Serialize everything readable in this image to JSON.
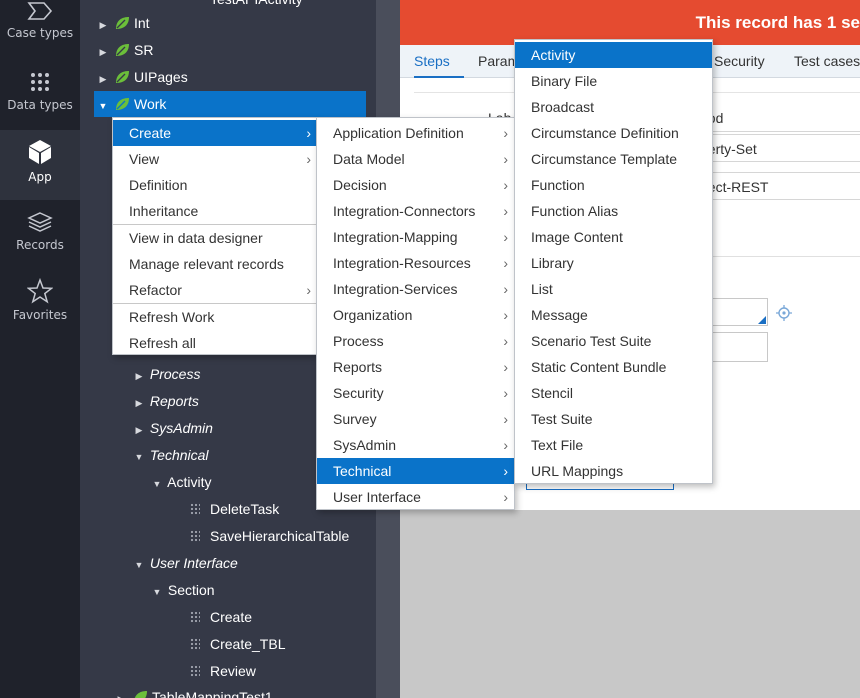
{
  "nav": [
    {
      "label": "Case types",
      "icon": "case-types-icon"
    },
    {
      "label": "Data types",
      "icon": "data-types-icon"
    },
    {
      "label": "App",
      "icon": "app-cube-icon"
    },
    {
      "label": "Records",
      "icon": "records-stack-icon"
    },
    {
      "label": "Favorites",
      "icon": "favorites-star-icon"
    }
  ],
  "tree": {
    "partial_top": "TestAPIActivity",
    "items": [
      {
        "label": "Int"
      },
      {
        "label": "SR"
      },
      {
        "label": "UIPages"
      },
      {
        "label": "Work"
      },
      {
        "label": "Process"
      },
      {
        "label": "Reports"
      },
      {
        "label": "SysAdmin"
      },
      {
        "label": "Technical"
      },
      {
        "label": "Activity"
      },
      {
        "label": "DeleteTask"
      },
      {
        "label": "SaveHierarchicalTable"
      },
      {
        "label": "User Interface"
      },
      {
        "label": "Section"
      },
      {
        "label": "Create"
      },
      {
        "label": "Create_TBL"
      },
      {
        "label": "Review"
      },
      {
        "label": "TableMappingTest1"
      }
    ]
  },
  "banner": {
    "text": "This record has 1 se",
    "color": "#e54b30"
  },
  "tabs": [
    "Steps",
    "Param",
    "Security",
    "Test cases"
  ],
  "form": {
    "label_partial": "Lab",
    "method_label": "hod",
    "method_value_1": "perty-Set",
    "method_value_2": "nect-REST"
  },
  "context_menu": {
    "items": [
      "Create",
      "View",
      "Definition",
      "Inheritance",
      "View in data designer",
      "Manage relevant records",
      "Refactor",
      "Refresh Work",
      "Refresh all"
    ]
  },
  "create_menu": {
    "items": [
      "Application Definition",
      "Data Model",
      "Decision",
      "Integration-Connectors",
      "Integration-Mapping",
      "Integration-Resources",
      "Integration-Services",
      "Organization",
      "Process",
      "Reports",
      "Security",
      "Survey",
      "SysAdmin",
      "Technical",
      "User Interface"
    ]
  },
  "technical_menu": {
    "items": [
      "Activity",
      "Binary File",
      "Broadcast",
      "Circumstance Definition",
      "Circumstance Template",
      "Function",
      "Function Alias",
      "Image Content",
      "Library",
      "List",
      "Message",
      "Scenario Test Suite",
      "Static Content Bundle",
      "Stencil",
      "Test Suite",
      "Text File",
      "URL Mappings"
    ]
  },
  "colors": {
    "accent": "#0a73c9",
    "leaf": "#6bbf3a",
    "rail": "#1f222b",
    "tree": "#353947"
  }
}
